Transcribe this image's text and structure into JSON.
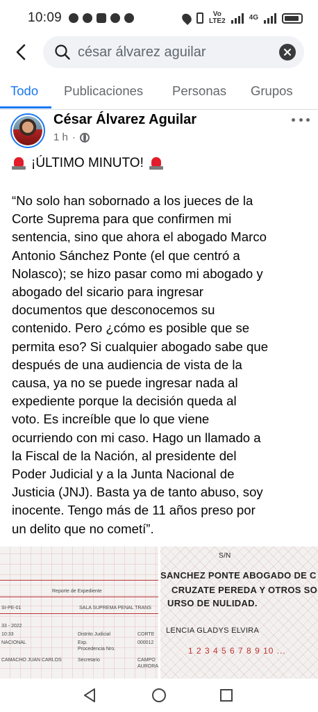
{
  "status_bar": {
    "time": "10:09",
    "network_top": "Vo",
    "network_bottom": "LTE2",
    "network_type": "4G"
  },
  "search": {
    "query": "césar álvarez aguilar"
  },
  "tabs": [
    {
      "label": "Todo",
      "active": true
    },
    {
      "label": "Publicaciones",
      "active": false
    },
    {
      "label": "Personas",
      "active": false
    },
    {
      "label": "Grupos",
      "active": false
    }
  ],
  "post": {
    "author": "César Álvarez Aguilar",
    "time": "1 h",
    "separator": "·",
    "headline": "¡ÚLTIMO MINUTO!",
    "body_lines": [
      "“No solo han sobornado a los jueces de la",
      "Corte Suprema para que confirmen mi",
      "sentencia, sino que ahora el abogado Marco",
      "Antonio Sánchez Ponte (el que centró a",
      "Nolasco); se hizo pasar como mi abogado y",
      "abogado del sicario para ingresar",
      "documentos que desconocemos su",
      "contenido. Pero ¿cómo es posible que se",
      "permita eso? Si cualquier abogado sabe que",
      "después de una audiencia de vista de la",
      "causa, ya no se puede ingresar nada al",
      "expediente porque la decisión queda al",
      "voto. Es increíble que lo que viene",
      "ocurriendo con mi caso. Hago un llamado a",
      "la Fiscal de la Nación, al presidente del",
      "Poder Judicial y a la Junta Nacional de",
      "Justicia (JNJ). Basta ya de tanto abuso, soy",
      "inocente. Tengo más de 11 años preso por",
      "un delito que no cometí”."
    ]
  },
  "images": {
    "left": {
      "title": "Reporte de Expediente",
      "code": "SI-PE-01",
      "sala": "SALA SUPREMA PENAL TRANS",
      "date": "33 - 2022",
      "time": "10:33",
      "row1_left": "NACIONAL",
      "row1_mid": "Distrito Judicial",
      "row1_right": "CORTE",
      "row2_mid": "Exp.",
      "row2_mid2": "Procedencia Nro.",
      "row2_right": "000012",
      "row3_left": "CAMACHO JUAN CARLOS",
      "row3_mid": "Secretario",
      "row3_right": "CAMPO",
      "row3_right2": "AURORA"
    },
    "right": {
      "header": "S/N",
      "line1": "SANCHEZ PONTE ABOGADO DE C",
      "line2": "CRUZATE PEREDA Y OTROS SO",
      "line3": "URSO DE NULIDAD.",
      "line4": "LENCIA GLADYS ELVIRA",
      "numbers": "1 2 3 4 5 6 7 8 9 10 ..."
    }
  }
}
